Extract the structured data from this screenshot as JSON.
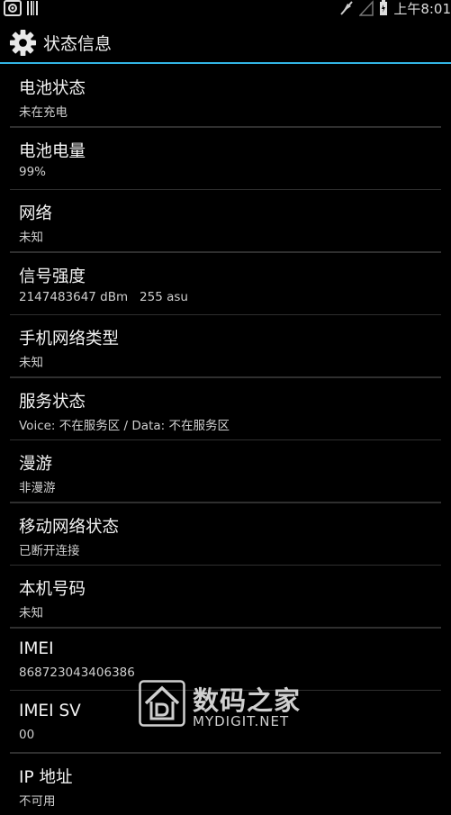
{
  "status_bar": {
    "time": "上午8:01",
    "icons": [
      "screenshot-icon",
      "barcode-icon",
      "mute-icon",
      "signal-icon",
      "battery-icon"
    ]
  },
  "action_bar": {
    "icon": "gear-icon",
    "title": "状态信息"
  },
  "items": [
    {
      "label": "电池状态",
      "value": "未在充电"
    },
    {
      "label": "电池电量",
      "value": "99%"
    },
    {
      "label": "网络",
      "value": "未知"
    },
    {
      "label": "信号强度",
      "value": "2147483647 dBm   255 asu"
    },
    {
      "label": "手机网络类型",
      "value": "未知"
    },
    {
      "label": "服务状态",
      "value": "Voice: 不在服务区 / Data: 不在服务区"
    },
    {
      "label": "漫游",
      "value": "非漫游"
    },
    {
      "label": "移动网络状态",
      "value": "已断开连接"
    },
    {
      "label": "本机号码",
      "value": "未知"
    },
    {
      "label": "IMEI",
      "value": "868723043406386"
    },
    {
      "label": "IMEI SV",
      "value": "00"
    },
    {
      "label": "IP 地址",
      "value": "不可用"
    }
  ],
  "watermark": {
    "name_cn": "数码之家",
    "name_en": "MYDIGIT.NET"
  },
  "colors": {
    "background": "#000000",
    "accent_divider": "#33b5e5",
    "text_primary": "#f2f2f2",
    "text_secondary": "#cfcfcf"
  }
}
